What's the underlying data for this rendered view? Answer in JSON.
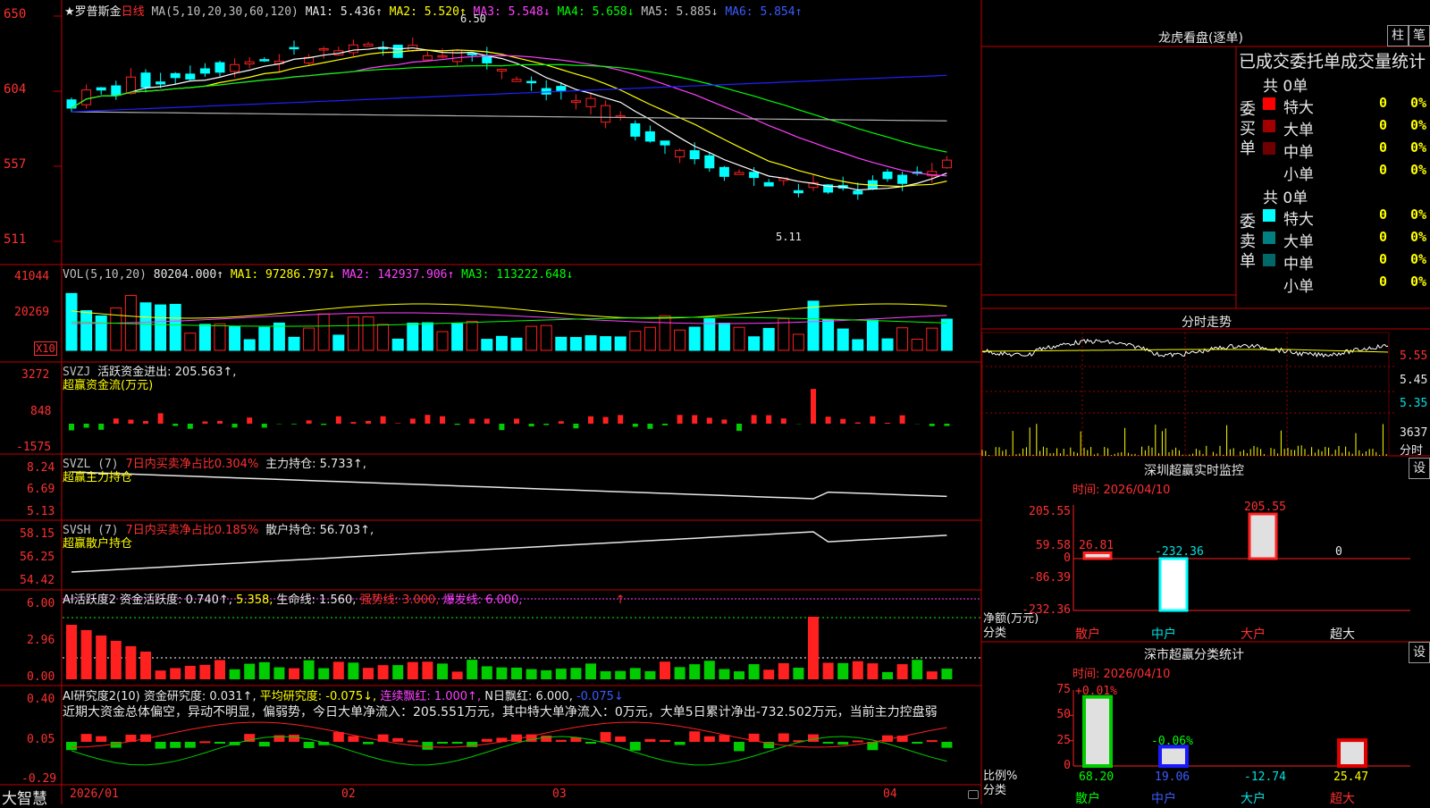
{
  "main": {
    "name_prefix": "★罗普斯金",
    "period": "日线",
    "ma_label": "MA(5,10,20,30,60,120)",
    "ma1": "MA1: 5.436↑",
    "ma2": "MA2: 5.520↑",
    "ma3": "MA3: 5.548↓",
    "ma4": "MA4: 5.658↓",
    "ma5": "MA5: 5.885↓",
    "ma6": "MA6: 5.854↑",
    "y_ticks": [
      "650",
      "604",
      "557",
      "511"
    ],
    "high_mark": "6.50",
    "low_mark": "5.11"
  },
  "vol": {
    "label": "VOL(5,10,20)",
    "value": "80204.000↑",
    "ma1": "MA1: 97286.797↓",
    "ma2": "MA2: 142937.906↑",
    "ma3": "MA3: 113222.648↓",
    "y_ticks": [
      "41044",
      "20269"
    ],
    "unit": "X10"
  },
  "svzj": {
    "label": "SVZJ",
    "desc": "活跃资金进出: 205.563↑,",
    "sub": "超赢资金流(万元)",
    "y_ticks": [
      "3272",
      "848",
      "-1575"
    ]
  },
  "svzl": {
    "label": "SVZL (7)",
    "desc": "7日内买卖净占比0.304%",
    "main_hold": "主力持仓: 5.733↑,",
    "sub": "超赢主力持仓",
    "y_ticks": [
      "8.24",
      "6.69",
      "5.13"
    ]
  },
  "svsh": {
    "label": "SVSH (7)",
    "desc": "7日内买卖净占比0.185%",
    "retail_hold": "散户持仓: 56.703↑,",
    "sub": "超赢散户持仓",
    "y_ticks": [
      "58.15",
      "56.25",
      "54.42"
    ]
  },
  "ai1": {
    "label": "AI活跃度2",
    "desc": "资金活跃度: 0.740↑,",
    "v2": "5.358,",
    "life": "生命线: 1.560,",
    "strong": "强势线: 3.000,",
    "burst": "爆发线: 6.000,",
    "arrow": "↑",
    "y_ticks": [
      "6.00",
      "2.96",
      "0.00"
    ]
  },
  "ai2": {
    "label": "AI研究度2(10)",
    "desc": "资金研究度: 0.031↑,",
    "avg": "平均研究度: -0.075↓,",
    "cont": "连续飘红: 1.000↑,",
    "nday": "N日飘红: 6.000,",
    "neg": "-0.075↓",
    "y_ticks": [
      "0.40",
      "0.05",
      "-0.29"
    ],
    "text": "近期大资金总体偏空，异动不明显，偏弱势，今日大单净流入：205.551万元，其中特大单净流入：0万元，大单5日累计净出-732.502万元，当前主力控盘弱"
  },
  "xaxis": {
    "labels": [
      "2026/01",
      "02",
      "03",
      "04"
    ],
    "brand": "大智慧"
  },
  "lhb": {
    "title": "龙虎看盘(逐单)",
    "btn1": "柱",
    "btn2": "笔",
    "stats_title": "已成交委托单成交量统计",
    "buy": {
      "label": "委买单",
      "total": "共 0单",
      "rows": [
        {
          "name": "特大",
          "num": "0",
          "pct": "0%",
          "color": "#ff0000"
        },
        {
          "name": "大单",
          "num": "0",
          "pct": "0%",
          "color": "#a00000"
        },
        {
          "name": "中单",
          "num": "0",
          "pct": "0%",
          "color": "#700000"
        },
        {
          "name": "小单",
          "num": "0",
          "pct": "0%",
          "color": "#000000"
        }
      ]
    },
    "sell": {
      "label": "委卖单",
      "total": "共 0单",
      "rows": [
        {
          "name": "特大",
          "num": "0",
          "pct": "0%",
          "color": "#00ffff"
        },
        {
          "name": "大单",
          "num": "0",
          "pct": "0%",
          "color": "#008080"
        },
        {
          "name": "中单",
          "num": "0",
          "pct": "0%",
          "color": "#006868"
        },
        {
          "name": "小单",
          "num": "0",
          "pct": "0%",
          "color": "#000000"
        }
      ]
    }
  },
  "fenshi": {
    "title": "分时走势",
    "y_ticks": [
      "5.55",
      "5.45",
      "5.35"
    ],
    "vol_value": "3637",
    "vol_label": "分时"
  },
  "szmon": {
    "title": "深圳超赢实时监控",
    "btn": "设",
    "time": "时间: 2026/04/10",
    "y_ticks": [
      "205.55",
      "59.58",
      "0",
      "-86.39",
      "-232.36"
    ],
    "y_label": "净额(万元)",
    "x_label": "分类",
    "cats": [
      "散户",
      "中户",
      "大户",
      "超大"
    ],
    "values": [
      26.81,
      -232.36,
      205.55,
      0
    ],
    "value_labels": [
      "26.81",
      "-232.36",
      "205.55",
      "0"
    ]
  },
  "szcls": {
    "title": "深市超赢分类统计",
    "btn": "设",
    "time": "时间: 2026/04/10",
    "y_ticks": [
      "75",
      "50",
      "25",
      "0"
    ],
    "y_label": "比例%",
    "x_label": "分类",
    "cats": [
      "散户",
      "中户",
      "大户",
      "超大"
    ],
    "pct_labels": [
      "+0.01%",
      "-0.06%",
      "",
      ""
    ],
    "values": [
      68.2,
      19.06,
      -12.74,
      25.47
    ],
    "value_labels": [
      "68.20",
      "19.06",
      "-12.74",
      "25.47"
    ],
    "bar_colors": [
      "#00cc00",
      "#1a1aff",
      "#00aaaa",
      "#e00000"
    ]
  },
  "chart_data": [
    {
      "type": "bar",
      "title": "深圳超赢实时监控",
      "categories": [
        "散户",
        "中户",
        "大户",
        "超大"
      ],
      "values": [
        26.81,
        -232.36,
        205.55,
        0
      ],
      "ylabel": "净额(万元)",
      "xlabel": "分类",
      "ylim": [
        -232.36,
        205.55
      ]
    },
    {
      "type": "bar",
      "title": "深市超赢分类统计",
      "categories": [
        "散户",
        "中户",
        "大户",
        "超大"
      ],
      "values": [
        68.2,
        19.06,
        -12.74,
        25.47
      ],
      "ylabel": "比例%",
      "xlabel": "分类",
      "ylim": [
        0,
        75
      ]
    }
  ]
}
